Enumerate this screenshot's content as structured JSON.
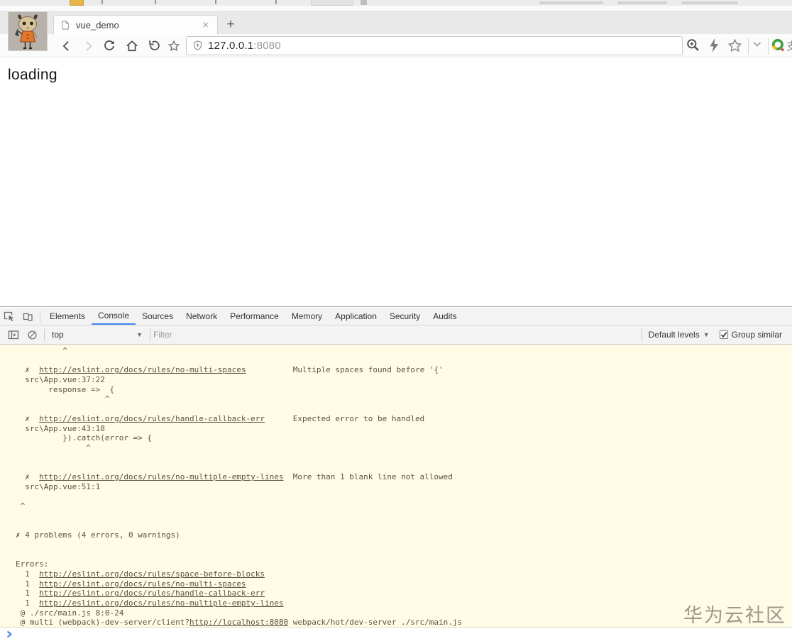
{
  "browser": {
    "tab": {
      "title": "vue_demo",
      "close_glyph": "×",
      "new_tab_glyph": "+"
    },
    "address": {
      "host": "127.0.0.1",
      "port": ":8080"
    },
    "logo_partial_text": "支"
  },
  "page": {
    "content": "loading"
  },
  "devtools": {
    "tabs": [
      "Elements",
      "Console",
      "Sources",
      "Network",
      "Performance",
      "Memory",
      "Application",
      "Security",
      "Audits"
    ],
    "active_tab": "Console",
    "toolbar": {
      "context": "top",
      "context_caret": "▼",
      "filter_placeholder": "Filter",
      "levels_label": "Default levels",
      "levels_caret": "▼",
      "group_similar_label": "Group similar",
      "group_similar_checked": true
    },
    "console": {
      "lines": [
        [
          {
            "t": "          ^"
          }
        ],
        [],
        [
          {
            "t": "  ✗  "
          },
          {
            "t": "http://eslint.org/docs/rules/no-multi-spaces",
            "link": true
          },
          {
            "t": "          Multiple spaces found before '{'"
          }
        ],
        [
          {
            "t": "  src\\App.vue:37:22"
          }
        ],
        [
          {
            "t": "       response =>  {"
          }
        ],
        [
          {
            "t": "                   ^"
          }
        ],
        [],
        [
          {
            "t": "  ✗  "
          },
          {
            "t": "http://eslint.org/docs/rules/handle-callback-err",
            "link": true
          },
          {
            "t": "      Expected error to be handled"
          }
        ],
        [
          {
            "t": "  src\\App.vue:43:18"
          }
        ],
        [
          {
            "t": "          }).catch(error => {"
          }
        ],
        [
          {
            "t": "               ^"
          }
        ],
        [],
        [],
        [
          {
            "t": "  ✗  "
          },
          {
            "t": "http://eslint.org/docs/rules/no-multiple-empty-lines",
            "link": true
          },
          {
            "t": "  More than 1 blank line not allowed"
          }
        ],
        [
          {
            "t": "  src\\App.vue:51:1"
          }
        ],
        [],
        [
          {
            "t": " ^"
          }
        ],
        [],
        [],
        [
          {
            "t": "✗ 4 problems (4 errors, 0 warnings)"
          }
        ],
        [],
        [],
        [
          {
            "t": "Errors:"
          }
        ],
        [
          {
            "t": "  1  "
          },
          {
            "t": "http://eslint.org/docs/rules/space-before-blocks",
            "link": true
          }
        ],
        [
          {
            "t": "  1  "
          },
          {
            "t": "http://eslint.org/docs/rules/no-multi-spaces",
            "link": true
          }
        ],
        [
          {
            "t": "  1  "
          },
          {
            "t": "http://eslint.org/docs/rules/handle-callback-err",
            "link": true
          }
        ],
        [
          {
            "t": "  1  "
          },
          {
            "t": "http://eslint.org/docs/rules/no-multiple-empty-lines",
            "link": true
          }
        ],
        [
          {
            "t": " @ ./src/main.js 8:0-24"
          }
        ],
        [
          {
            "t": " @ multi (webpack)-dev-server/client?"
          },
          {
            "t": "http://localhost:8080",
            "link": true
          },
          {
            "t": " webpack/hot/dev-server ./src/main.js"
          }
        ]
      ]
    }
  },
  "watermark": "华为云社区",
  "colors": {
    "console_bg": "#fffbe5",
    "console_text": "#575446",
    "active_tab_underline": "#4285f4",
    "prompt_chevron": "#3b78e7",
    "ring_logo_green": "#43a047",
    "ring_logo_yellow": "#f5b800"
  }
}
